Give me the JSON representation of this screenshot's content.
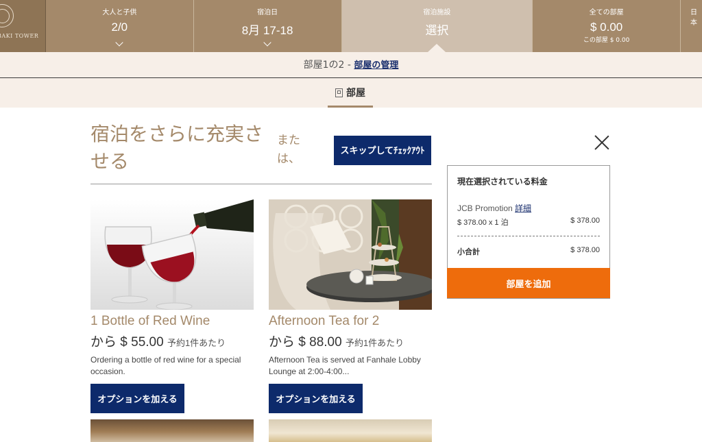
{
  "header": {
    "logo_text": "BAKI TOWER",
    "guests": {
      "label": "大人と子供",
      "value": "2/0"
    },
    "dates": {
      "label": "宿泊日",
      "value": "8月 17-18"
    },
    "room": {
      "label": "宿泊施設",
      "value": "選択"
    },
    "total": {
      "label": "全ての部屋",
      "value": "$ 0.00",
      "sub": "この部屋 $ 0.00"
    },
    "language": {
      "label": "日本"
    }
  },
  "room_bar": {
    "text": "部屋1の2 - ",
    "link": "部屋の管理"
  },
  "tab": {
    "label": "部屋"
  },
  "main": {
    "headline": "宿泊をさらに充実させる",
    "or_text": "または、",
    "skip_button": "スキップしてﾁｪｯｸｱｳﾄ"
  },
  "options": [
    {
      "title": "1 Bottle of Red Wine",
      "price": "から $ 55.00",
      "per": "予約1件あたり",
      "description": "Ordering a bottle of red wine for a special occasion.",
      "button": "オプションを加える"
    },
    {
      "title": "Afternoon Tea for 2",
      "price": "から $ 88.00",
      "per": "予約1件あたり",
      "description": "Afternoon Tea is served at Fanhale Lobby Lounge at 2:00-4:00...",
      "button": "オプションを加える"
    }
  ],
  "summary": {
    "heading": "現在選択されている料金",
    "rate_name": "JCB Promotion ",
    "details_link": "詳細",
    "line_desc": "$ 378.00 x 1 泊",
    "line_amount": "$ 378.00",
    "subtotal_label": "小合計",
    "subtotal_amount": "$ 378.00",
    "add_room_button": "部屋を追加"
  },
  "colors": {
    "brand_brown": "#a4896a",
    "navy": "#0d2a6b",
    "orange": "#ee6c0c",
    "cream": "#f7efe8"
  }
}
